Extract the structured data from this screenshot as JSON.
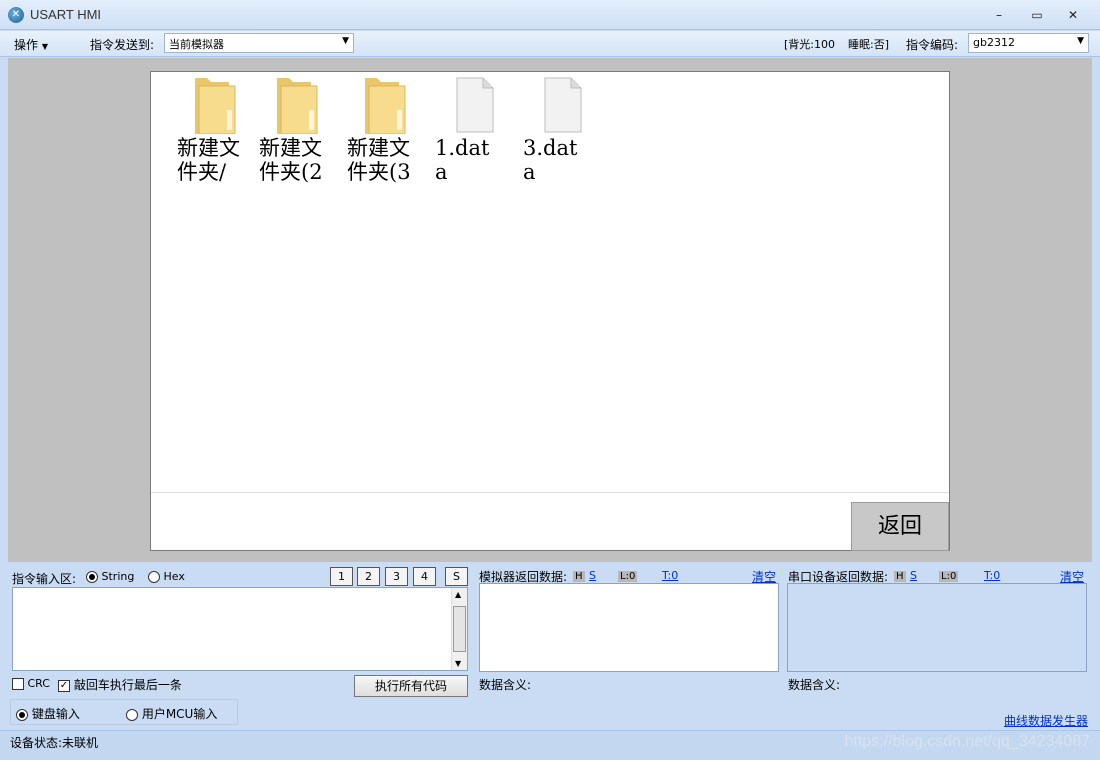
{
  "window": {
    "title": "USART HMI",
    "minimize": "–",
    "maximize": "▭",
    "close": "✕"
  },
  "menubar": {
    "operate": "操作",
    "send_to_label": "指令发送到:",
    "send_to_value": "当前模拟器",
    "backlight": "[背光:100",
    "sleep": "睡眠:否]",
    "encoding_label": "指令编码:",
    "encoding_value": "gb2312"
  },
  "screen": {
    "files": [
      {
        "name": "新建文件夹/",
        "icon": "folder-icon"
      },
      {
        "name": "新建文件夹(2",
        "icon": "folder-icon"
      },
      {
        "name": "新建文件夹(3",
        "icon": "folder-icon"
      },
      {
        "name": "1.data",
        "icon": "file-icon"
      },
      {
        "name": "3.data",
        "icon": "file-icon"
      }
    ],
    "back_button": "返回"
  },
  "input_area": {
    "label": "指令输入区:",
    "mode_string": "String",
    "mode_hex": "Hex",
    "slots": [
      "1",
      "2",
      "3",
      "4",
      "S"
    ],
    "crc": "CRC",
    "enter_exec": "敲回车执行最后一条",
    "run_all": "执行所有代码",
    "keyboard_input": "键盘输入",
    "mcu_input": "用户MCU输入"
  },
  "sim_return": {
    "label": "模拟器返回数据:",
    "h": "H",
    "s": "S",
    "l": "L:0",
    "t": "T:0",
    "clear": "清空",
    "meaning": "数据含义:"
  },
  "serial_return": {
    "label": "串口设备返回数据:",
    "h": "H",
    "s": "S",
    "l": "L:0",
    "t": "T:0",
    "clear": "清空",
    "meaning": "数据含义:"
  },
  "curve_link": "曲线数据发生器",
  "status": {
    "text": "设备状态:未联机",
    "watermark": "https://blog.csdn.net/qq_34234087"
  }
}
